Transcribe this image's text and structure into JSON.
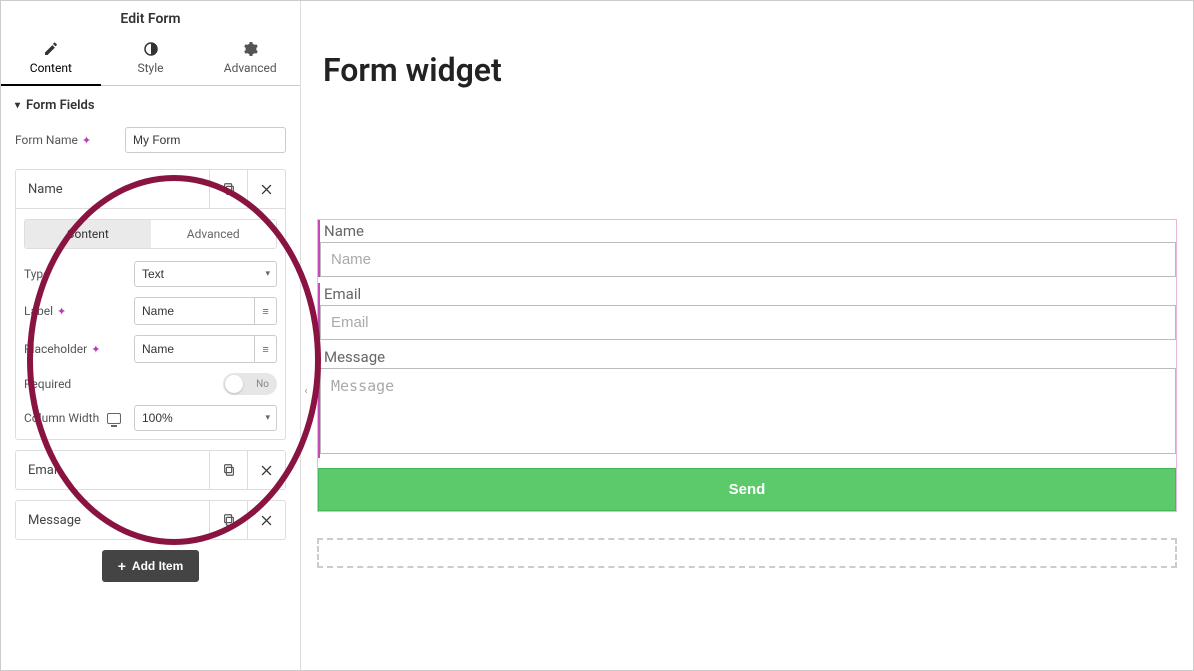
{
  "sidebar": {
    "title": "Edit Form",
    "tabs": [
      {
        "label": "Content"
      },
      {
        "label": "Style"
      },
      {
        "label": "Advanced"
      }
    ],
    "section": {
      "title": "Form Fields",
      "form_name_label": "Form Name",
      "form_name_value": "My Form"
    },
    "fields": [
      {
        "title": "Name",
        "expanded": true,
        "subtabs": {
          "content": "Content",
          "advanced": "Advanced"
        },
        "type_label": "Type",
        "type_value": "Text",
        "label_label": "Label",
        "label_value": "Name",
        "placeholder_label": "Placeholder",
        "placeholder_value": "Name",
        "required_label": "Required",
        "required_value": "No",
        "colwidth_label": "Column Width",
        "colwidth_value": "100%"
      },
      {
        "title": "Email",
        "expanded": false
      },
      {
        "title": "Message",
        "expanded": false
      }
    ],
    "add_item": "Add Item"
  },
  "main": {
    "heading": "Form widget",
    "form": {
      "name_label": "Name",
      "name_placeholder": "Name",
      "email_label": "Email",
      "email_placeholder": "Email",
      "message_label": "Message",
      "message_placeholder": "Message",
      "submit": "Send"
    }
  }
}
